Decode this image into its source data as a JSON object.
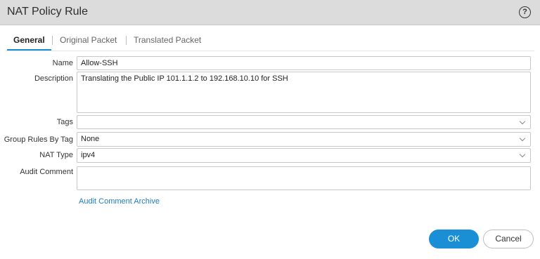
{
  "dialog": {
    "title": "NAT Policy Rule",
    "help_icon": "?"
  },
  "tabs": [
    {
      "label": "General",
      "active": true
    },
    {
      "label": "Original Packet",
      "active": false
    },
    {
      "label": "Translated Packet",
      "active": false
    }
  ],
  "form": {
    "name": {
      "label": "Name",
      "value": "Allow-SSH"
    },
    "description": {
      "label": "Description",
      "value": "Translating the Public IP 101.1.1.2 to 192.168.10.10 for SSH"
    },
    "tags": {
      "label": "Tags",
      "value": ""
    },
    "group_rules_by_tag": {
      "label": "Group Rules By Tag",
      "value": "None"
    },
    "nat_type": {
      "label": "NAT Type",
      "value": "ipv4"
    },
    "audit_comment": {
      "label": "Audit Comment",
      "value": ""
    },
    "audit_archive_link": "Audit Comment Archive"
  },
  "buttons": {
    "ok": "OK",
    "cancel": "Cancel"
  },
  "colors": {
    "accent": "#1a8fd6",
    "link": "#1e7dc1",
    "title_bar": "#dcdcdc"
  }
}
